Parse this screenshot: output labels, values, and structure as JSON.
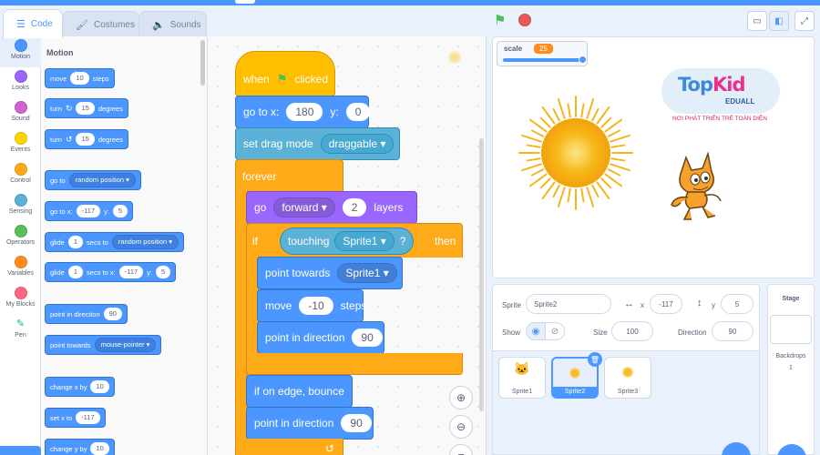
{
  "tabs": [
    {
      "label": "Code",
      "icon": "code-icon"
    },
    {
      "label": "Costumes",
      "icon": "brush-icon"
    },
    {
      "label": "Sounds",
      "icon": "speaker-icon"
    }
  ],
  "categories": [
    {
      "label": "Motion",
      "color": "#4c97ff"
    },
    {
      "label": "Looks",
      "color": "#9966ff"
    },
    {
      "label": "Sound",
      "color": "#cf63cf"
    },
    {
      "label": "Events",
      "color": "#ffd500"
    },
    {
      "label": "Control",
      "color": "#ffab19"
    },
    {
      "label": "Sensing",
      "color": "#5cb1d6"
    },
    {
      "label": "Operators",
      "color": "#59c059"
    },
    {
      "label": "Variables",
      "color": "#ff8c1a"
    },
    {
      "label": "My Blocks",
      "color": "#ff6680"
    },
    {
      "label": "Pen",
      "color": "#0fbd8c"
    }
  ],
  "palette": {
    "title": "Motion",
    "move": {
      "a": "move",
      "v": "10",
      "b": "steps"
    },
    "turn_right": {
      "a": "turn",
      "v": "15",
      "b": "degrees"
    },
    "turn_left": {
      "a": "turn",
      "v": "15",
      "b": "degrees"
    },
    "goto": {
      "a": "go to",
      "d": "random position"
    },
    "goto_xy": {
      "a": "go to x:",
      "x": "-117",
      "b": "y:",
      "y": "5"
    },
    "glide_to": {
      "a": "glide",
      "v": "1",
      "b": "secs to",
      "d": "random position"
    },
    "glide_xy": {
      "a": "glide",
      "v": "1",
      "b": "secs to x:",
      "x": "-117",
      "c": "y:",
      "y": "5"
    },
    "point_dir": {
      "a": "point in direction",
      "v": "90"
    },
    "point_towards": {
      "a": "point towards",
      "d": "mouse-pointer"
    },
    "change_x": {
      "a": "change x by",
      "v": "10"
    },
    "set_x": {
      "a": "set x to",
      "v": "-117"
    },
    "change_y": {
      "a": "change y by",
      "v": "10"
    }
  },
  "script": {
    "when_clicked": {
      "a": "when",
      "b": "clicked"
    },
    "goto_xy": {
      "a": "go to x:",
      "x": "180",
      "b": "y:",
      "y": "0"
    },
    "drag_mode": {
      "a": "set drag mode",
      "d": "draggable"
    },
    "forever": "forever",
    "go_layers": {
      "a": "go",
      "d": "forward",
      "v": "2",
      "b": "layers"
    },
    "if_touching": {
      "a": "if",
      "b": "touching",
      "d": "Sprite1",
      "q": "?",
      "c": "then"
    },
    "point_towards": {
      "a": "point towards",
      "d": "Sprite1"
    },
    "move": {
      "a": "move",
      "v": "-10",
      "b": "steps"
    },
    "point_dir_1": {
      "a": "point in direction",
      "v": "90"
    },
    "bounce": "if on edge, bounce",
    "point_dir_2": {
      "a": "point in direction",
      "v": "90"
    }
  },
  "stage": {
    "monitor": {
      "label": "scale",
      "value": "25",
      "fraction": 1.0
    },
    "logo": {
      "name_a": "Top",
      "name_b": "Kid",
      "sub": "EDUALL",
      "tagline": "NƠI PHÁT TRIỂN TRẺ TOÀN DIỆN"
    }
  },
  "sprite_info": {
    "sprite_label": "Sprite",
    "sprite_name": "Sprite2",
    "x_label": "x",
    "x": "-117",
    "y_label": "y",
    "y": "5",
    "show_label": "Show",
    "size_label": "Size",
    "size": "100",
    "direction_label": "Direction",
    "direction": "90"
  },
  "sprites": [
    "Sprite1",
    "Sprite2",
    "Sprite3"
  ],
  "stage_pane": {
    "title": "Stage",
    "backdrops_label": "Backdrops",
    "backdrops_count": "1"
  }
}
